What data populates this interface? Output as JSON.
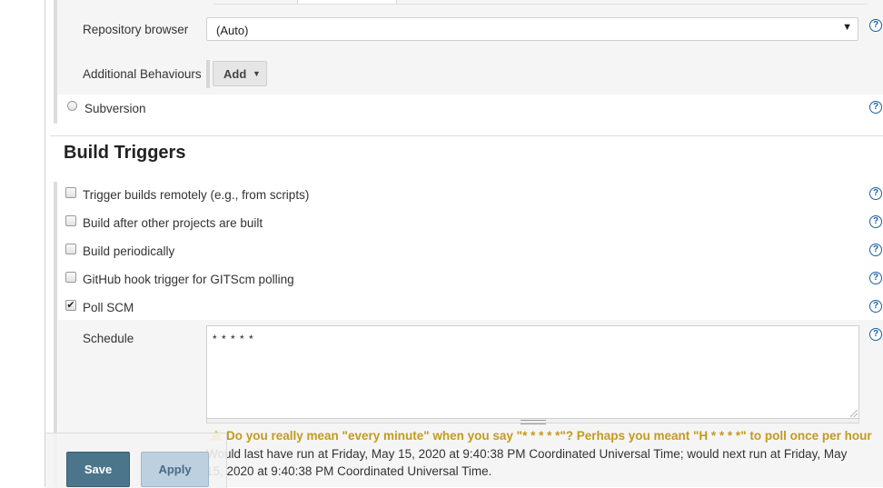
{
  "scm": {
    "repository_browser_label": "Repository browser",
    "repository_browser_value": "(Auto)",
    "additional_behaviours_label": "Additional Behaviours",
    "add_button_label": "Add",
    "subversion_label": "Subversion"
  },
  "build_triggers": {
    "title": "Build Triggers",
    "options": [
      {
        "label": "Trigger builds remotely (e.g., from scripts)",
        "checked": false
      },
      {
        "label": "Build after other projects are built",
        "checked": false
      },
      {
        "label": "Build periodically",
        "checked": false
      },
      {
        "label": "GitHub hook trigger for GITScm polling",
        "checked": false
      },
      {
        "label": "Poll SCM",
        "checked": true
      }
    ],
    "schedule_label": "Schedule",
    "schedule_value": "* * * * *",
    "warning": "Do you really mean \"every minute\" when you say \"* * * * *\"? Perhaps you meant \"H * * * *\" to poll once per hour",
    "run_info": "Would last have run at Friday, May 15, 2020 at 9:40:38 PM Coordinated Universal Time; would next run at Friday, May 15, 2020 at 9:40:38 PM Coordinated Universal Time."
  },
  "actions": {
    "save_label": "Save",
    "apply_label": "Apply"
  },
  "icons": {
    "help": "help-icon",
    "help_glyph": "?",
    "checkmark_glyph": "✔",
    "select_arrow_glyph": "▼",
    "caret_glyph": "▼"
  },
  "colors": {
    "save_button": "#4b758b",
    "apply_button": "#bcd0e0",
    "warning_text": "#c49a1e",
    "help_icon": "#1a5fa3"
  }
}
